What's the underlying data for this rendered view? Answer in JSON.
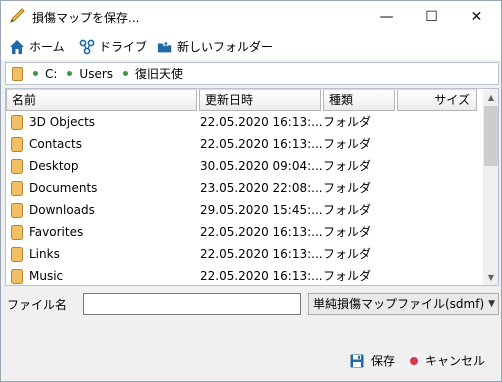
{
  "window": {
    "title": "損傷マップを保存...",
    "minimize_glyph": "—",
    "maximize_glyph": "☐",
    "close_glyph": "✕"
  },
  "toolbar": {
    "home_label": "ホーム",
    "drive_label": "ドライブ",
    "new_folder_label": "新しいフォルダー"
  },
  "breadcrumb": {
    "segments": [
      "C:",
      "Users",
      "復旧天使"
    ]
  },
  "filelist": {
    "columns": {
      "name": "名前",
      "date": "更新日時",
      "type": "種類",
      "size": "サイズ"
    },
    "rows": [
      {
        "name": "3D Objects",
        "date": "22.05.2020 16:13:...",
        "type": "フォルダ"
      },
      {
        "name": "Contacts",
        "date": "22.05.2020 16:13:...",
        "type": "フォルダ"
      },
      {
        "name": "Desktop",
        "date": "30.05.2020 09:04:...",
        "type": "フォルダ"
      },
      {
        "name": "Documents",
        "date": "23.05.2020 22:08:...",
        "type": "フォルダ"
      },
      {
        "name": "Downloads",
        "date": "29.05.2020 15:45:...",
        "type": "フォルダ"
      },
      {
        "name": "Favorites",
        "date": "22.05.2020 16:13:...",
        "type": "フォルダ"
      },
      {
        "name": "Links",
        "date": "22.05.2020 16:13:...",
        "type": "フォルダ"
      },
      {
        "name": "Music",
        "date": "22.05.2020 16:13:...",
        "type": "フォルダ"
      }
    ]
  },
  "filename": {
    "label": "ファイル名",
    "value": ""
  },
  "filetype": {
    "selected": "単純損傷マップファイル(sdmf)"
  },
  "footer": {
    "save_label": "保存",
    "cancel_label": "キャンセル"
  },
  "colors": {
    "folder_fill": "#f2c064",
    "folder_stroke": "#b8862a",
    "accent_blue": "#1f6aa5",
    "cancel_red": "#d9364a",
    "dot_green": "#3a9a3a"
  }
}
